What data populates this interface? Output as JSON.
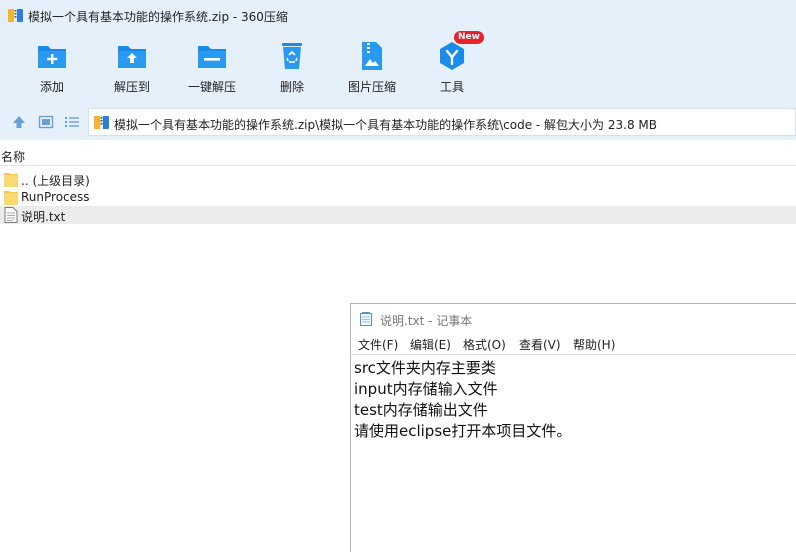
{
  "window": {
    "title": "模拟一个具有基本功能的操作系统.zip - 360压缩",
    "app_icon": "archive-icon"
  },
  "toolbar": {
    "items": [
      {
        "label": "添加",
        "icon": "add-folder-icon"
      },
      {
        "label": "解压到",
        "icon": "extract-folder-icon"
      },
      {
        "label": "一键解压",
        "icon": "oneclick-extract-icon"
      },
      {
        "label": "删除",
        "icon": "recycle-bin-icon"
      },
      {
        "label": "图片压缩",
        "icon": "image-compress-icon"
      },
      {
        "label": "工具",
        "icon": "tools-icon",
        "badge": "New"
      }
    ]
  },
  "address": {
    "path": "模拟一个具有基本功能的操作系统.zip\\模拟一个具有基本功能的操作系统\\code - 解包大小为 23.8 MB"
  },
  "filelist": {
    "column_header": "名称",
    "rows": [
      {
        "name": ".. (上级目录)",
        "icon": "folder-icon"
      },
      {
        "name": "RunProcess",
        "icon": "folder-icon"
      },
      {
        "name": "说明.txt",
        "icon": "text-file-icon",
        "selected": true
      }
    ]
  },
  "notepad": {
    "title": "说明.txt - 记事本",
    "menu": [
      "文件(F)",
      "编辑(E)",
      "格式(O)",
      "查看(V)",
      "帮助(H)"
    ],
    "lines": [
      "src文件夹内存主要类",
      "input内存储输入文件",
      "test内存储输出文件",
      "请使用eclipse打开本项目文件。"
    ]
  },
  "colors": {
    "chrome_bg": "#e6f0fb",
    "icon_blue": "#1a8be8",
    "badge_red": "#e8232d",
    "selected_row": "#ececec"
  }
}
